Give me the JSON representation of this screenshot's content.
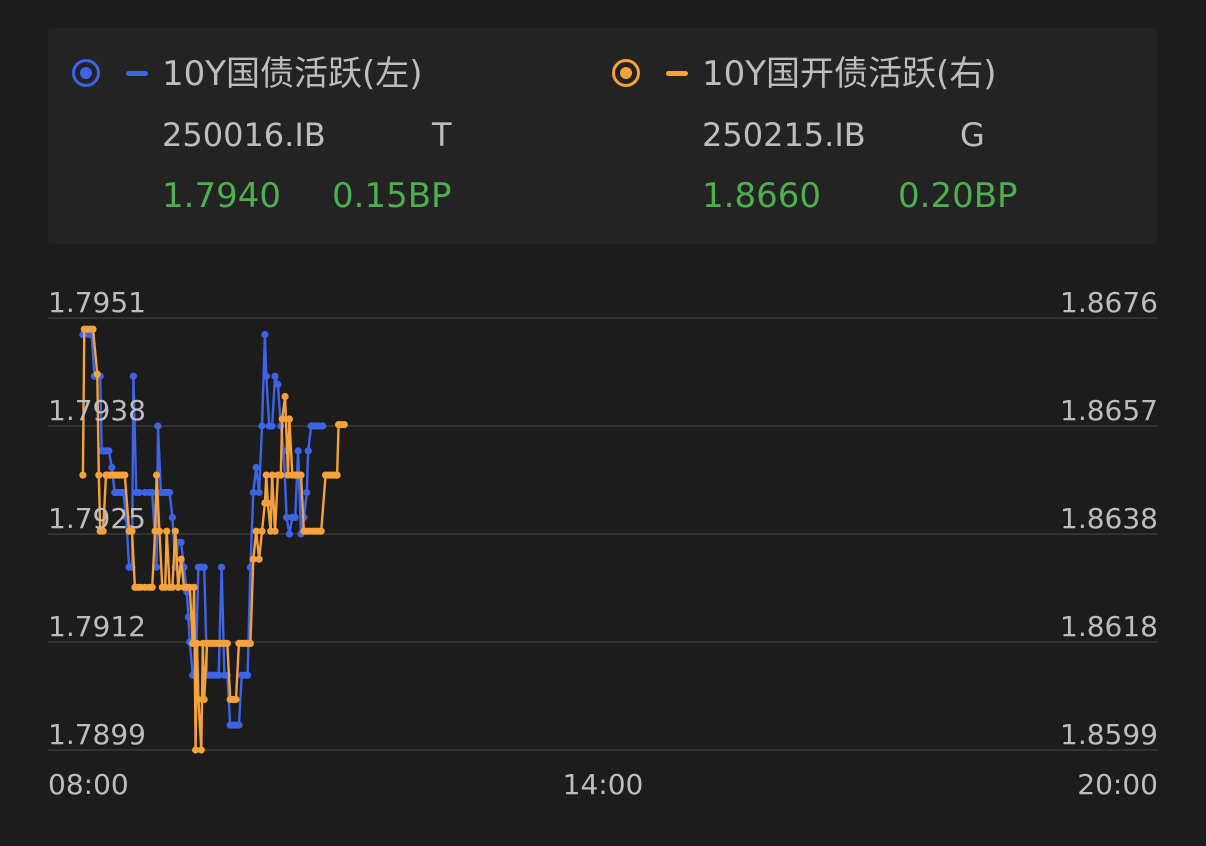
{
  "legend": {
    "series": [
      {
        "name": "10Y国债活跃(左)",
        "code": "250016.IB",
        "tag": "T",
        "value": "1.7940",
        "change": "0.15BP",
        "color": "#3d63e6"
      },
      {
        "name": "10Y国开债活跃(右)",
        "code": "250215.IB",
        "tag": "G",
        "value": "1.8660",
        "change": "0.20BP",
        "color": "#f5a23c"
      }
    ],
    "change_color": "#4caf50"
  },
  "chart_data": {
    "type": "line",
    "x_ticks": [
      "08:00",
      "14:00",
      "20:00"
    ],
    "x_range_minutes": [
      0,
      720
    ],
    "y_left": {
      "ticks": [
        "1.7951",
        "1.7938",
        "1.7925",
        "1.7912",
        "1.7899"
      ],
      "range": [
        1.7899,
        1.7951
      ]
    },
    "y_right": {
      "ticks": [
        "1.8676",
        "1.8657",
        "1.8638",
        "1.8618",
        "1.8599"
      ],
      "range": [
        1.8599,
        1.8676
      ]
    },
    "grid": true,
    "series": [
      {
        "axis": "left",
        "color": "#3d63e6",
        "points": [
          [
            2,
            1.7949
          ],
          [
            6,
            1.7949
          ],
          [
            8,
            1.7949
          ],
          [
            10,
            1.7944
          ],
          [
            12,
            1.7944
          ],
          [
            14,
            1.7944
          ],
          [
            15,
            1.7935
          ],
          [
            16,
            1.7935
          ],
          [
            18,
            1.7935
          ],
          [
            20,
            1.7935
          ],
          [
            22,
            1.7933
          ],
          [
            24,
            1.793
          ],
          [
            26,
            1.793
          ],
          [
            28,
            1.793
          ],
          [
            30,
            1.793
          ],
          [
            32,
            1.7927
          ],
          [
            34,
            1.7921
          ],
          [
            36,
            1.7921
          ],
          [
            37,
            1.7944
          ],
          [
            39,
            1.793
          ],
          [
            41,
            1.793
          ],
          [
            45,
            1.793
          ],
          [
            48,
            1.793
          ],
          [
            50,
            1.793
          ],
          [
            53,
            1.7921
          ],
          [
            54,
            1.7938
          ],
          [
            56,
            1.793
          ],
          [
            58,
            1.793
          ],
          [
            60,
            1.793
          ],
          [
            62,
            1.793
          ],
          [
            64,
            1.7927
          ],
          [
            66,
            1.7921
          ],
          [
            68,
            1.7924
          ],
          [
            70,
            1.7924
          ],
          [
            72,
            1.7921
          ],
          [
            74,
            1.7918
          ],
          [
            75,
            1.7915
          ],
          [
            76,
            1.7912
          ],
          [
            78,
            1.7908
          ],
          [
            80,
            1.7908
          ],
          [
            82,
            1.7921
          ],
          [
            84,
            1.7921
          ],
          [
            86,
            1.7921
          ],
          [
            88,
            1.7908
          ],
          [
            90,
            1.7908
          ],
          [
            92,
            1.7908
          ],
          [
            94,
            1.7908
          ],
          [
            96,
            1.7908
          ],
          [
            98,
            1.7921
          ],
          [
            100,
            1.7908
          ],
          [
            102,
            1.7908
          ],
          [
            104,
            1.7902
          ],
          [
            106,
            1.7902
          ],
          [
            108,
            1.7902
          ],
          [
            110,
            1.7902
          ],
          [
            112,
            1.7908
          ],
          [
            114,
            1.7908
          ],
          [
            116,
            1.7908
          ],
          [
            118,
            1.7921
          ],
          [
            120,
            1.793
          ],
          [
            122,
            1.7933
          ],
          [
            124,
            1.793
          ],
          [
            126,
            1.7938
          ],
          [
            128,
            1.7949
          ],
          [
            129,
            1.7944
          ],
          [
            131,
            1.7938
          ],
          [
            133,
            1.7938
          ],
          [
            135,
            1.7944
          ],
          [
            137,
            1.7943
          ],
          [
            139,
            1.7938
          ],
          [
            141,
            1.7935
          ],
          [
            143,
            1.7927
          ],
          [
            145,
            1.7925
          ],
          [
            147,
            1.7927
          ],
          [
            149,
            1.7927
          ],
          [
            151,
            1.7935
          ],
          [
            153,
            1.7925
          ],
          [
            155,
            1.7927
          ],
          [
            157,
            1.793
          ],
          [
            158,
            1.7935
          ],
          [
            160,
            1.7938
          ],
          [
            162,
            1.7938
          ],
          [
            164,
            1.7938
          ],
          [
            166,
            1.7938
          ],
          [
            168,
            1.7938
          ]
        ]
      },
      {
        "axis": "right",
        "color": "#f5a23c",
        "points": [
          [
            2,
            1.8648
          ],
          [
            3,
            1.8674
          ],
          [
            5,
            1.8674
          ],
          [
            7,
            1.8674
          ],
          [
            9,
            1.8674
          ],
          [
            12,
            1.8666
          ],
          [
            13,
            1.8648
          ],
          [
            14,
            1.8638
          ],
          [
            16,
            1.8638
          ],
          [
            18,
            1.8648
          ],
          [
            19,
            1.8648
          ],
          [
            21,
            1.8648
          ],
          [
            23,
            1.8648
          ],
          [
            25,
            1.8648
          ],
          [
            27,
            1.8648
          ],
          [
            29,
            1.8648
          ],
          [
            31,
            1.8648
          ],
          [
            34,
            1.8638
          ],
          [
            36,
            1.8638
          ],
          [
            38,
            1.8628
          ],
          [
            40,
            1.8628
          ],
          [
            42,
            1.8628
          ],
          [
            45,
            1.8628
          ],
          [
            48,
            1.8628
          ],
          [
            50,
            1.8628
          ],
          [
            52,
            1.8638
          ],
          [
            53,
            1.8648
          ],
          [
            55,
            1.8638
          ],
          [
            57,
            1.8628
          ],
          [
            59,
            1.8628
          ],
          [
            60,
            1.8638
          ],
          [
            62,
            1.8628
          ],
          [
            64,
            1.8628
          ],
          [
            66,
            1.8638
          ],
          [
            68,
            1.8628
          ],
          [
            70,
            1.8633
          ],
          [
            72,
            1.8628
          ],
          [
            74,
            1.8628
          ],
          [
            76,
            1.8628
          ],
          [
            78,
            1.8618
          ],
          [
            79,
            1.8628
          ],
          [
            80,
            1.8599
          ],
          [
            81,
            1.8618
          ],
          [
            82,
            1.8608
          ],
          [
            84,
            1.8599
          ],
          [
            85,
            1.8618
          ],
          [
            86,
            1.8608
          ],
          [
            88,
            1.8618
          ],
          [
            90,
            1.8618
          ],
          [
            92,
            1.8618
          ],
          [
            94,
            1.8618
          ],
          [
            96,
            1.8618
          ],
          [
            98,
            1.8618
          ],
          [
            100,
            1.8618
          ],
          [
            102,
            1.8618
          ],
          [
            104,
            1.8608
          ],
          [
            106,
            1.8608
          ],
          [
            108,
            1.8608
          ],
          [
            110,
            1.8618
          ],
          [
            112,
            1.8618
          ],
          [
            114,
            1.8618
          ],
          [
            116,
            1.8618
          ],
          [
            118,
            1.8618
          ],
          [
            120,
            1.8633
          ],
          [
            122,
            1.8638
          ],
          [
            124,
            1.8633
          ],
          [
            126,
            1.8638
          ],
          [
            128,
            1.8643
          ],
          [
            129,
            1.8648
          ],
          [
            130,
            1.8643
          ],
          [
            132,
            1.8638
          ],
          [
            133,
            1.8648
          ],
          [
            135,
            1.8638
          ],
          [
            137,
            1.8648
          ],
          [
            139,
            1.8648
          ],
          [
            140,
            1.8658
          ],
          [
            142,
            1.8662
          ],
          [
            144,
            1.8648
          ],
          [
            145,
            1.8658
          ],
          [
            147,
            1.8648
          ],
          [
            149,
            1.8648
          ],
          [
            151,
            1.8648
          ],
          [
            153,
            1.8648
          ],
          [
            155,
            1.8638
          ],
          [
            157,
            1.8638
          ],
          [
            159,
            1.8638
          ],
          [
            161,
            1.8638
          ],
          [
            163,
            1.8638
          ],
          [
            165,
            1.8638
          ],
          [
            167,
            1.8638
          ],
          [
            170,
            1.8648
          ],
          [
            172,
            1.8648
          ],
          [
            174,
            1.8648
          ],
          [
            176,
            1.8648
          ],
          [
            178,
            1.8648
          ],
          [
            179,
            1.8657
          ],
          [
            181,
            1.8657
          ],
          [
            183,
            1.8657
          ]
        ]
      }
    ]
  }
}
